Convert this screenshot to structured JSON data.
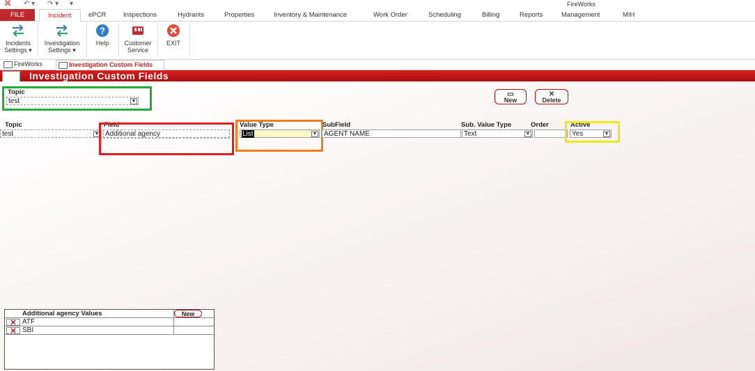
{
  "app": {
    "title": "FireWorks"
  },
  "ribbon_tabs": [
    {
      "label": "FILE"
    },
    {
      "label": "Incident"
    },
    {
      "label": "ePCR"
    },
    {
      "label": "Inspections"
    },
    {
      "label": "Hydrants"
    },
    {
      "label": "Properties"
    },
    {
      "label": "Inventory & Maintenance"
    },
    {
      "label": "Work Order"
    },
    {
      "label": "Scheduling"
    },
    {
      "label": "Billing"
    },
    {
      "label": "Reports"
    },
    {
      "label": "Management"
    },
    {
      "label": "MIH"
    }
  ],
  "ribbon_buttons": [
    {
      "line1": "Incidents",
      "line2": "Settings ▾"
    },
    {
      "line1": "Investigation",
      "line2": "Settings ▾"
    },
    {
      "line1": "Help",
      "line2": ""
    },
    {
      "line1": "Customer",
      "line2": "Service"
    },
    {
      "line1": "EXIT",
      "line2": ""
    }
  ],
  "doc_tabs": [
    {
      "label": "FireWorks"
    },
    {
      "label": "Investigation Custom Fields"
    }
  ],
  "form": {
    "title": "Investigation Custom Fields",
    "topic_label": "Topic",
    "topic_value": "test",
    "new_label": "New",
    "delete_label": "Delete"
  },
  "grid": {
    "headers": {
      "topic": "Topic",
      "field": "Field",
      "value_type": "Value Type",
      "subfield": "SubField",
      "sub_value_type": "Sub. Value Type",
      "order": "Order",
      "active": "Active"
    },
    "row": {
      "topic": "test",
      "field": "Additional agency",
      "value_type": "List",
      "subfield": "AGENT NAME",
      "sub_value_type": "Text",
      "order": "",
      "active": "Yes"
    }
  },
  "subform": {
    "title": "Additional agency Values",
    "new_label": "New",
    "values": [
      "ATF",
      "SBI"
    ]
  },
  "colors": {
    "accent": "#c0282d",
    "highlight_green": "#1fae3a",
    "highlight_red": "#e01c24",
    "highlight_orange": "#f07d1e",
    "highlight_yellow": "#f5e60d"
  }
}
